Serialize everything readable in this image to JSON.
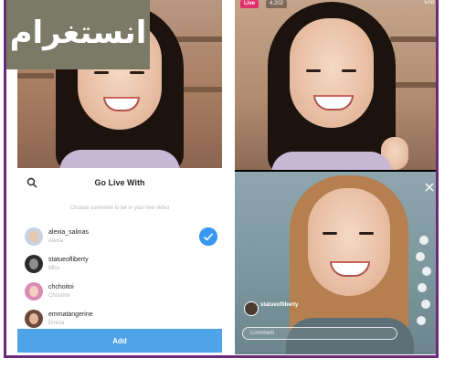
{
  "banner": {
    "text": "انستغرام"
  },
  "left_phone": {
    "sheet": {
      "title": "Go Live With",
      "subtitle": "Choose someone to be in your live video",
      "users": [
        {
          "username": "alexia_salinas",
          "subname": "Alexia",
          "selected": true
        },
        {
          "username": "statueofliberty",
          "subname": "Miss",
          "selected": false
        },
        {
          "username": "chchoitoi",
          "subname": "Christine",
          "selected": false
        },
        {
          "username": "emmatangerine",
          "subname": "Emma",
          "selected": false
        }
      ],
      "add_label": "Add"
    }
  },
  "right_phone": {
    "live_label": "Live",
    "viewer_count": "4,202",
    "end_label": "End",
    "comment_username": "statueofliberty",
    "comment_placeholder": "Comment"
  },
  "colors": {
    "frame": "#6e2a7a",
    "accent_blue": "#3897f0",
    "add_button": "#4fa3e8",
    "live_pink": "#e1306c",
    "banner_bg": "#7a7a66"
  },
  "icons": [
    "search-icon",
    "check-icon",
    "close-icon",
    "heart-icon"
  ]
}
